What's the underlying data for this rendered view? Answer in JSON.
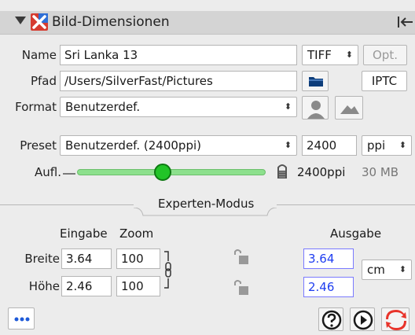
{
  "panel": {
    "title": "Bild-Dimensionen"
  },
  "name": {
    "label": "Name",
    "value": "Sri Lanka 13",
    "format": "TIFF ↕",
    "options_button": "Opt."
  },
  "path": {
    "label": "Pfad",
    "value": "/Users/SilverFast/Pictures",
    "iptc_button": "IPTC"
  },
  "format": {
    "label": "Format",
    "value": "Benutzerdef."
  },
  "preset": {
    "label": "Preset",
    "value": "Benutzerdef. (2400ppi)",
    "resolution_value": "2400",
    "unit": "ppi"
  },
  "resolution": {
    "label": "Aufl.",
    "value_text": "2400ppi",
    "size_text": "30 MB",
    "slider_fraction": 0.44
  },
  "expert": {
    "label": "Experten-Modus"
  },
  "dimensions": {
    "input_header": "Eingabe",
    "zoom_header": "Zoom",
    "output_header": "Ausgabe",
    "width_label": "Breite",
    "height_label": "Höhe",
    "width_input": "3.64",
    "height_input": "2.46",
    "width_zoom": "100",
    "height_zoom": "100",
    "width_output": "3.64",
    "height_output": "2.46",
    "unit": "cm"
  },
  "icons": {
    "more": "more-icon",
    "help": "help-icon",
    "play": "play-icon",
    "reset": "reset-icon"
  },
  "colors": {
    "accent_blue": "#1f3ef0",
    "slider_green": "#22c428",
    "reset_red": "#e8342b"
  }
}
